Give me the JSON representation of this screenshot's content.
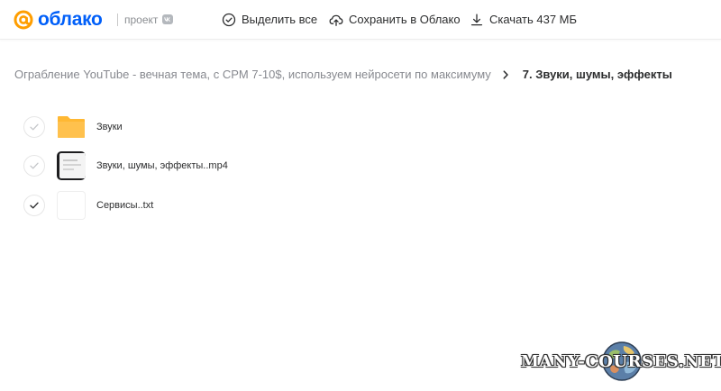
{
  "header": {
    "logo_text": "облако",
    "logo_sub": "проект",
    "actions": [
      {
        "label": "Выделить все",
        "icon": "check-circle-icon"
      },
      {
        "label": "Сохранить в Облако",
        "icon": "cloud-upload-icon"
      },
      {
        "label": "Скачать 437 МБ",
        "icon": "download-icon"
      }
    ]
  },
  "breadcrumb": {
    "parent": "Ограбление YouTube - вечная тема, с CPM 7-10$, используем нейросети по максимуму",
    "current": "7. Звуки, шумы, эффекты"
  },
  "files": [
    {
      "name": "Звуки",
      "type": "folder",
      "checked": false
    },
    {
      "name": "Звуки, шумы, эффекты..mp4",
      "type": "video",
      "checked": false
    },
    {
      "name": "Сервисы..txt",
      "type": "text",
      "checked": true
    }
  ],
  "watermark": {
    "text": "MANY-COURSES.NET"
  },
  "colors": {
    "brand_orange": "#ff9e00",
    "brand_blue": "#005ff9",
    "folder_yellow": "#ffc14d",
    "text_primary": "#2c2d2e",
    "text_secondary": "#87898f"
  }
}
